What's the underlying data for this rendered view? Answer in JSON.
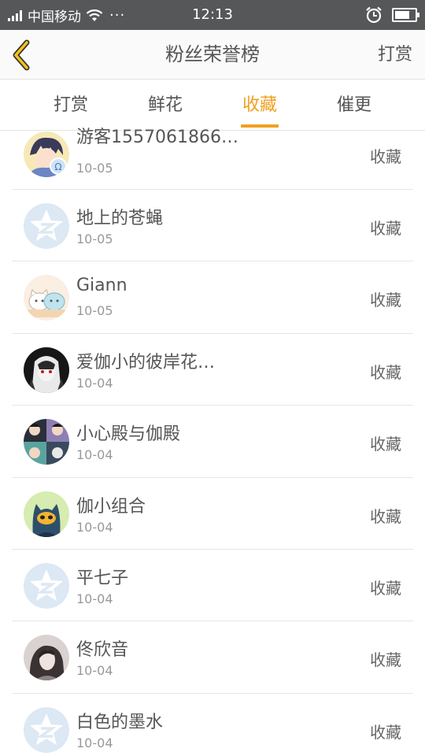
{
  "status_bar": {
    "carrier": "中国移动",
    "dots": "···",
    "time": "12:13"
  },
  "nav": {
    "back_icon": "chevron-left-icon",
    "title": "粉丝荣誉榜",
    "right_label": "打赏"
  },
  "tabs": [
    {
      "label": "打赏",
      "active": false
    },
    {
      "label": "鲜花",
      "active": false
    },
    {
      "label": "收藏",
      "active": true
    },
    {
      "label": "催更",
      "active": false
    }
  ],
  "colors": {
    "accent": "#f0a020",
    "status_bar_bg": "#555759",
    "default_avatar": "#dce8f3"
  },
  "fans": [
    {
      "name": "游客1557061866…",
      "date": "10-05",
      "action": "收藏",
      "avatar": "anime-boy"
    },
    {
      "name": "地上的苍蝇",
      "date": "10-05",
      "action": "收藏",
      "avatar": "default-star"
    },
    {
      "name": "Giann",
      "date": "10-05",
      "action": "收藏",
      "avatar": "cute-cats"
    },
    {
      "name": "爱伽小的彼岸花…",
      "date": "10-04",
      "action": "收藏",
      "avatar": "dark-anime"
    },
    {
      "name": "小心殿与伽殿",
      "date": "10-04",
      "action": "收藏",
      "avatar": "collage"
    },
    {
      "name": "伽小组合",
      "date": "10-04",
      "action": "收藏",
      "avatar": "cat-mask"
    },
    {
      "name": "平七子",
      "date": "10-04",
      "action": "收藏",
      "avatar": "default-star"
    },
    {
      "name": "佟欣音",
      "date": "10-04",
      "action": "收藏",
      "avatar": "portrait"
    },
    {
      "name": "白色的墨水",
      "date": "10-04",
      "action": "收藏",
      "avatar": "default-star"
    }
  ]
}
